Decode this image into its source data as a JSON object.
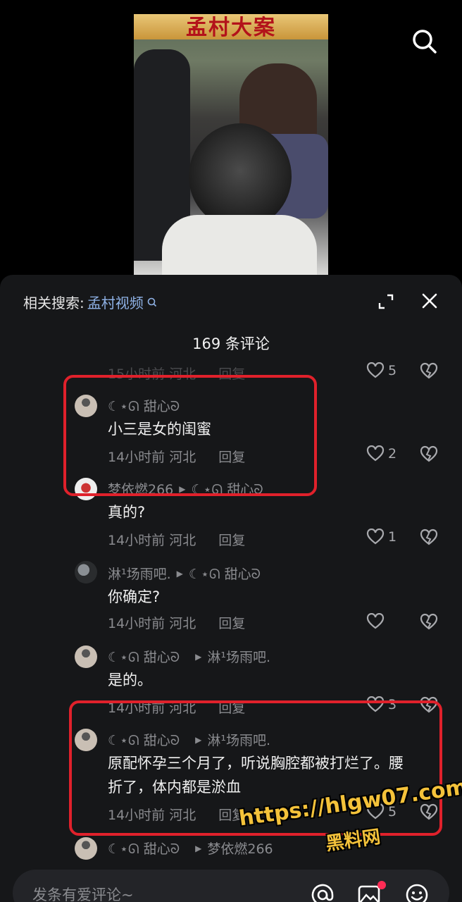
{
  "video": {
    "banner_text": "孟村大案"
  },
  "header": {
    "related_label": "相关搜索:",
    "related_keyword": "孟村视频"
  },
  "comment_count": "169 条评论",
  "comments": [
    {
      "name": "",
      "text": "",
      "meta_time": "15小时前 河北",
      "reply": "回复",
      "likes": "5"
    },
    {
      "name": "☾⋆ᘏ 甜心ᘐ",
      "text": "小三是女的闺蜜",
      "meta_time": "14小时前 河北",
      "reply": "回复",
      "likes": "2"
    },
    {
      "name": "梦依燃266",
      "reply_to": "☾⋆ᘏ 甜心ᘐ",
      "text": "真的?",
      "meta_time": "14小时前 河北",
      "reply": "回复",
      "likes": "1"
    },
    {
      "name": "淋¹场雨吧.",
      "reply_to": "☾⋆ᘏ 甜心ᘐ",
      "text": "你确定?",
      "meta_time": "14小时前 河北",
      "reply": "回复",
      "likes": ""
    },
    {
      "name": "☾⋆ᘏ 甜心ᘐ",
      "reply_to": "淋¹场雨吧.",
      "text": "是的。",
      "meta_time": "14小时前 河北",
      "reply": "回复",
      "likes": "3"
    },
    {
      "name": "☾⋆ᘏ 甜心ᘐ",
      "reply_to": "淋¹场雨吧.",
      "text": "原配怀孕三个月了，听说胸腔都被打烂了。腰折了，体内都是淤血",
      "meta_time": "14小时前 河北",
      "reply": "回复",
      "likes": "5"
    },
    {
      "name": "☾⋆ᘏ 甜心ᘐ",
      "reply_to": "梦依燃266"
    }
  ],
  "input": {
    "placeholder": "发条有爱评论~"
  },
  "watermark": {
    "url": "https://hlgw07.com",
    "brand": "黑料网"
  },
  "colors": {
    "highlight_box": "#e0212b",
    "link": "#8fb2e6",
    "watermark": "#f4c23a"
  }
}
